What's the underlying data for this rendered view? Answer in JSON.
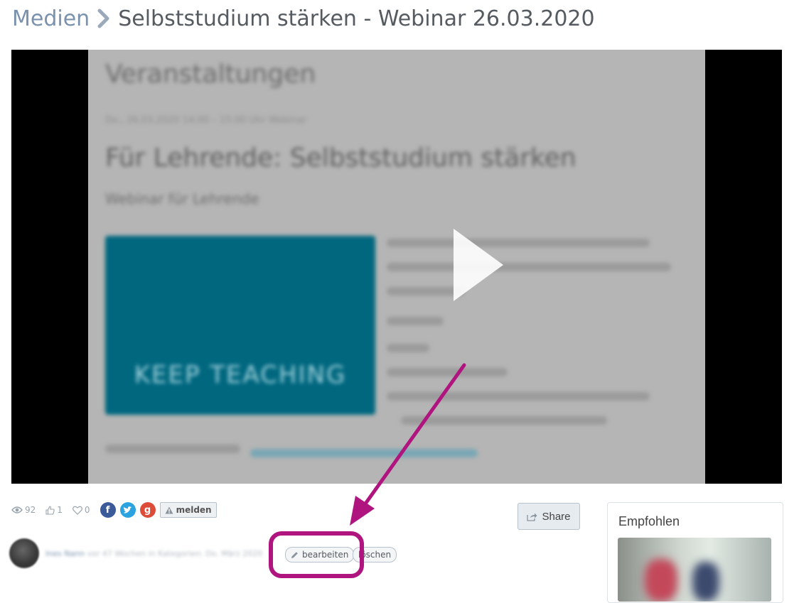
{
  "breadcrumb": {
    "section": "Medien",
    "title": "Selbststudium stärken - Webinar 26.03.2020"
  },
  "video": {
    "heading": "Veranstaltungen",
    "meta": "Do., 26.03.2020 14:00 – 15:00 Uhr Webinar",
    "title": "Für Lehrende: Selbststudium stärken",
    "subtitle": "Webinar für Lehrende",
    "banner_text": "KEEP TEACHING"
  },
  "stats": {
    "views": "92",
    "likes": "1",
    "favorites": "0",
    "report_label": "melden"
  },
  "share": {
    "label": "Share"
  },
  "author": {
    "name": "Ines Nann",
    "info": "vor 47 Wochen in Kategorien: Do. März 2020"
  },
  "actions": {
    "edit_label": "bearbeiten",
    "delete_label": "löschen"
  },
  "sidebar": {
    "title": "Empfohlen"
  },
  "colors": {
    "accent_link": "#7a92ad",
    "annotation": "#b0157f",
    "teal": "#00677f"
  }
}
